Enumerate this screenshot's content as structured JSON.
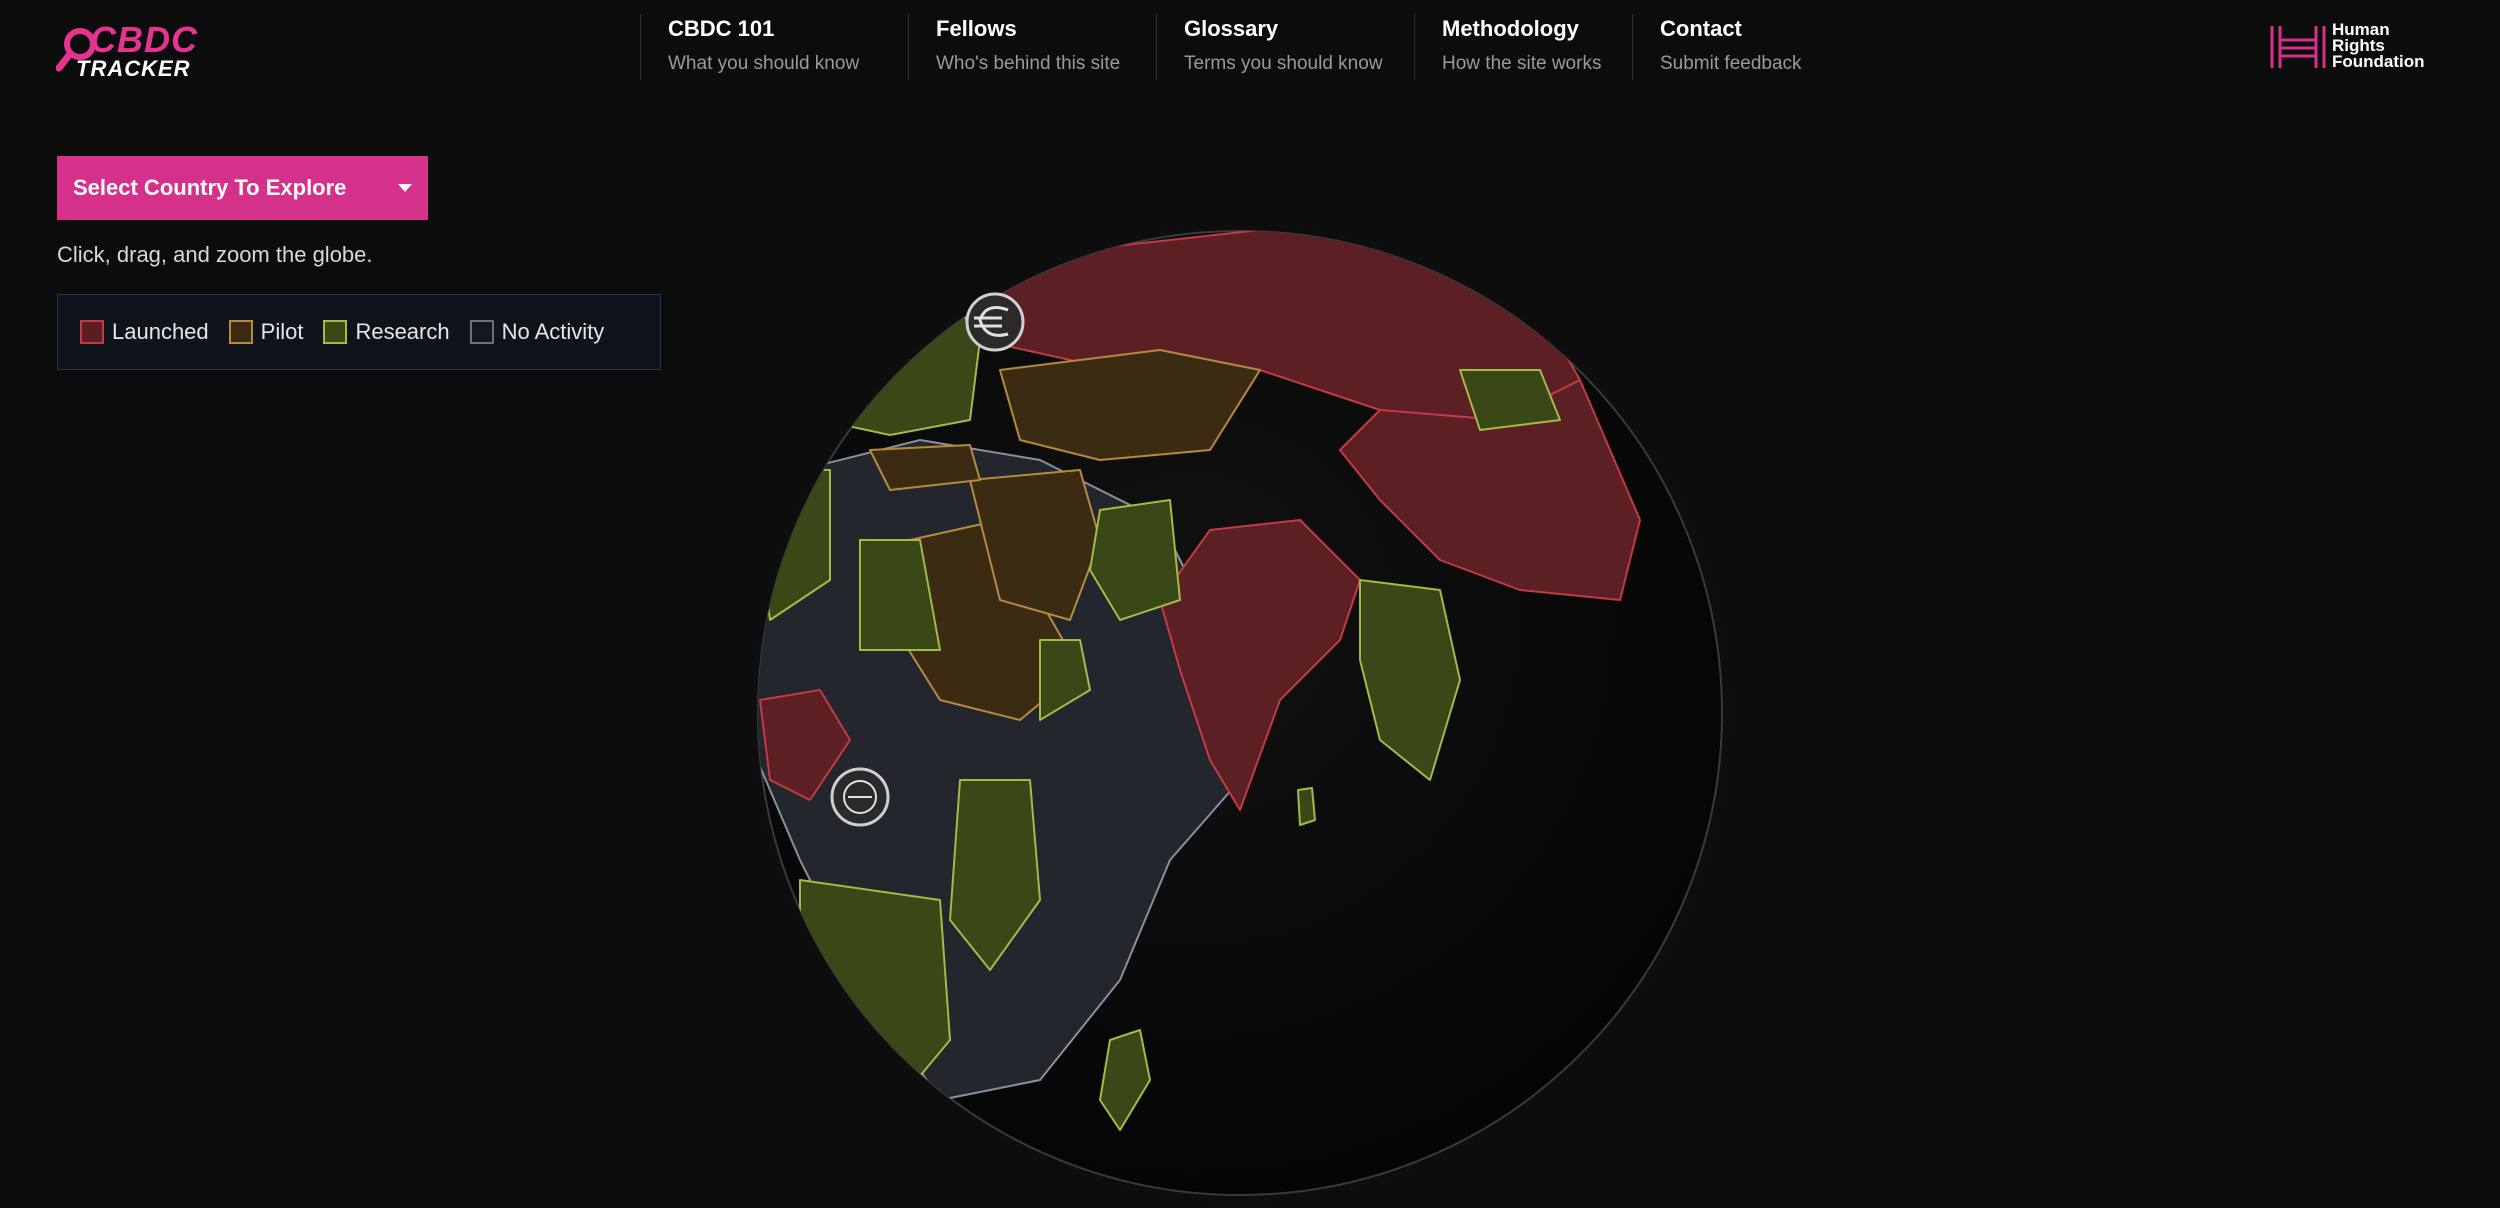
{
  "brand": {
    "logo_line1": "CBDC",
    "logo_line2": "TRACKER",
    "accent_color": "#d6318a"
  },
  "nav": [
    {
      "title": "CBDC 101",
      "subtitle": "What you should know"
    },
    {
      "title": "Fellows",
      "subtitle": "Who's behind this site"
    },
    {
      "title": "Glossary",
      "subtitle": "Terms you should know"
    },
    {
      "title": "Methodology",
      "subtitle": "How the site works"
    },
    {
      "title": "Contact",
      "subtitle": "Submit feedback"
    }
  ],
  "partner": {
    "line1": "Human",
    "line2": "Rights",
    "line3": "Foundation"
  },
  "controls": {
    "select_label": "Select Country To Explore",
    "hint": "Click, drag, and zoom the globe."
  },
  "legend": [
    {
      "label": "Launched",
      "color": "#c23a45"
    },
    {
      "label": "Pilot",
      "color": "#b58a40"
    },
    {
      "label": "Research",
      "color": "#a5b84a"
    },
    {
      "label": "No Activity",
      "color": "#6a7080"
    }
  ],
  "map_markers": [
    {
      "icon": "euro-coin-icon"
    },
    {
      "icon": "currency-coin-icon"
    }
  ]
}
